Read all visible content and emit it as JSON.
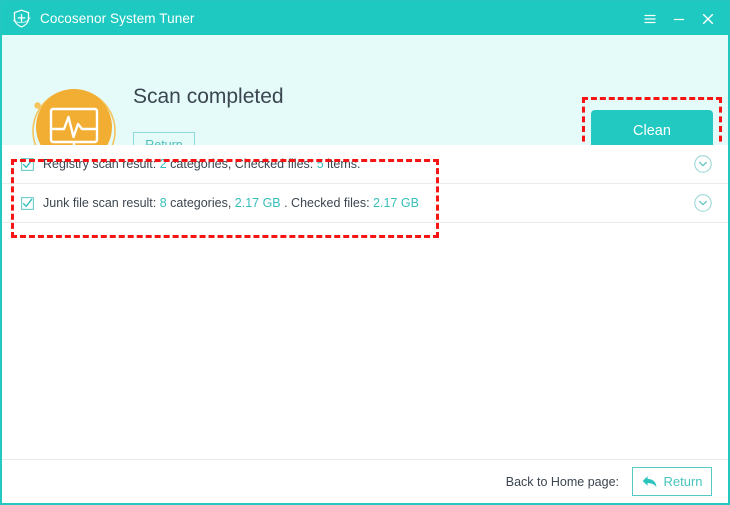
{
  "window": {
    "title": "Cocosenor System Tuner",
    "logo_icon": "shield-plus-icon",
    "controls": [
      {
        "name": "menu-button",
        "icon": "hamburger-icon"
      },
      {
        "name": "minimize-button",
        "icon": "minimize-icon"
      },
      {
        "name": "close-button",
        "icon": "close-icon"
      }
    ]
  },
  "header": {
    "status_icon": "monitor-heartbeat-icon",
    "title": "Scan completed",
    "return_label": "Return",
    "clean_label": "Clean"
  },
  "results": [
    {
      "checked": true,
      "expand_icon": "chevron-down-circle-icon",
      "parts": [
        {
          "text": "Registry scan result: ",
          "highlight": false
        },
        {
          "text": "2",
          "highlight": true
        },
        {
          "text": " categories, Checked files: ",
          "highlight": false
        },
        {
          "text": "5",
          "highlight": true
        },
        {
          "text": " items.",
          "highlight": false
        }
      ]
    },
    {
      "checked": true,
      "expand_icon": "chevron-down-circle-icon",
      "parts": [
        {
          "text": "Junk file scan result: ",
          "highlight": false
        },
        {
          "text": "8",
          "highlight": true
        },
        {
          "text": " categories, ",
          "highlight": false
        },
        {
          "text": "2.17 GB",
          "highlight": true
        },
        {
          "text": " . Checked files: ",
          "highlight": false
        },
        {
          "text": "2.17 GB",
          "highlight": true
        }
      ]
    }
  ],
  "footer": {
    "label": "Back to Home page:",
    "return_label": "Return",
    "back_icon": "back-arrow-icon"
  },
  "colors": {
    "brand_teal": "#1DC9C0",
    "header_bg": "#E4FBFA",
    "accent_orange": "#F2AE33",
    "annotation_red": "#F71414",
    "text_dark": "#3C4650",
    "highlight_teal": "#35BFBA"
  }
}
